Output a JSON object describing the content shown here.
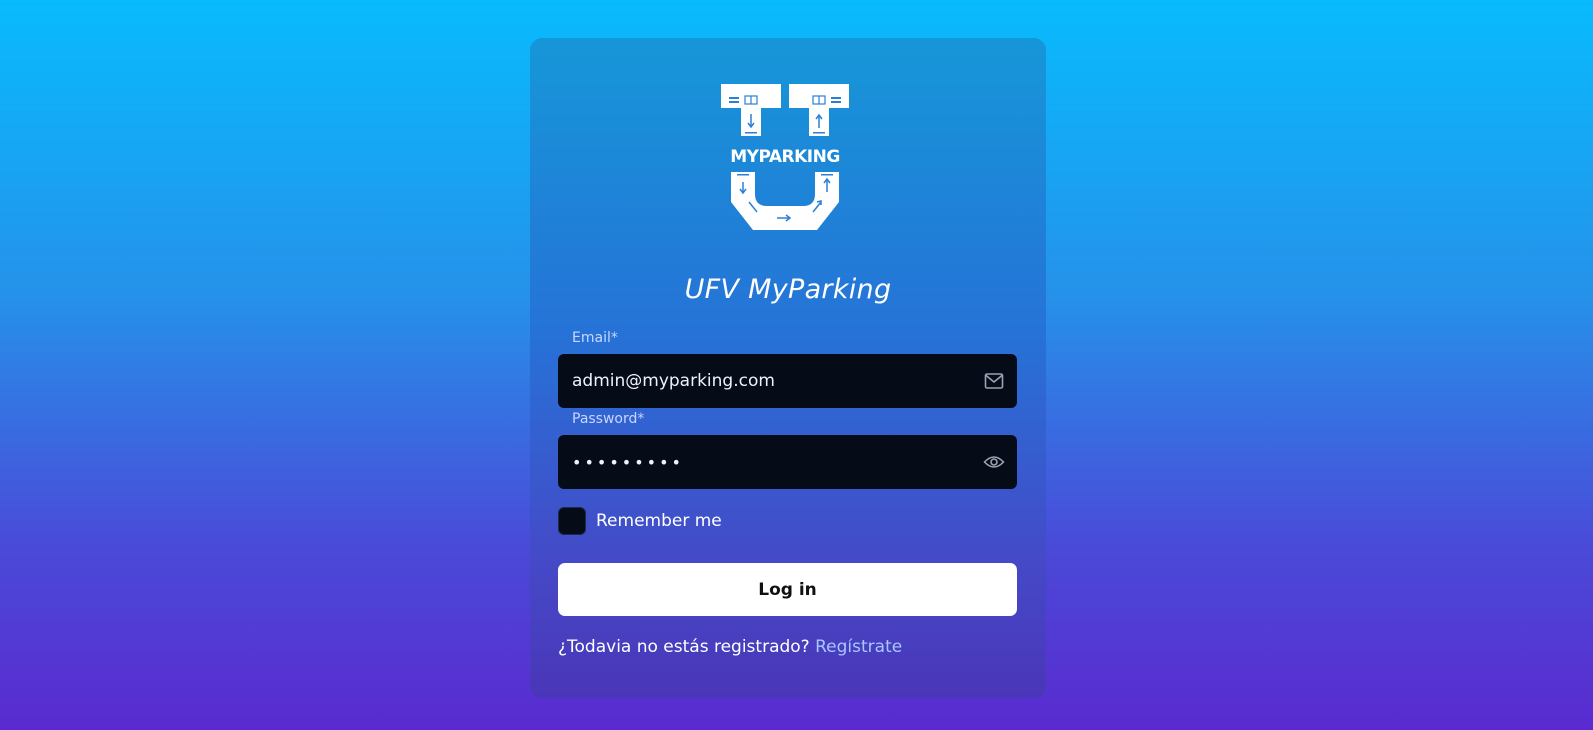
{
  "app": {
    "title": "UFV MyParking",
    "logo_text": "MYPARKING"
  },
  "form": {
    "email": {
      "label": "Email*",
      "value": "admin@myparking.com",
      "icon": "mail-icon"
    },
    "password": {
      "label": "Password*",
      "value": "•••••••••",
      "icon": "eye-icon"
    },
    "remember": {
      "label": "Remember me",
      "checked": false
    },
    "submit_label": "Log in"
  },
  "footer": {
    "prompt": "¿Todavia no estás registrado?",
    "link_label": "Regístrate"
  },
  "colors": {
    "background_top": "#08bbfd",
    "background_bottom": "#5a2ad0",
    "input_bg": "#050b17",
    "link": "#a8c6ff"
  }
}
